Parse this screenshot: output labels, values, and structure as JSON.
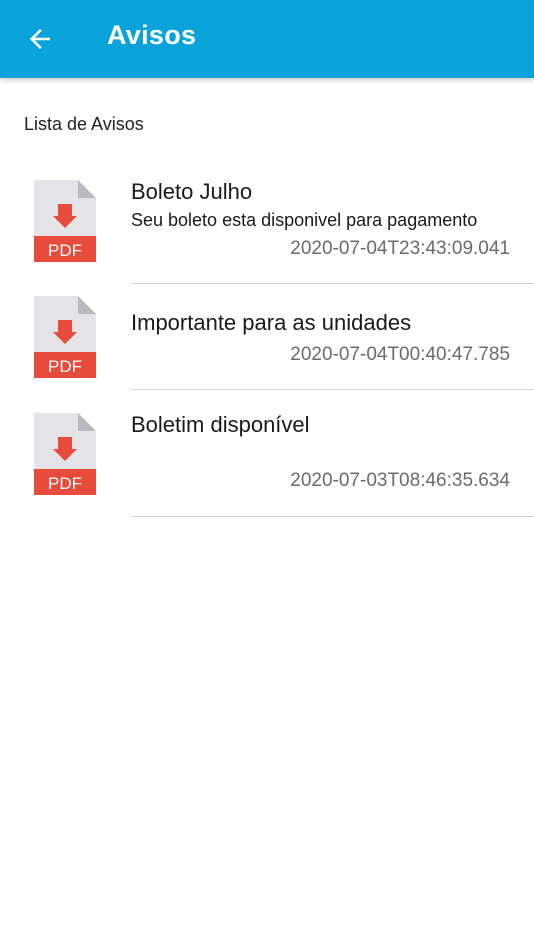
{
  "appbar": {
    "title": "Avisos",
    "back_icon": "arrow-left-icon",
    "color": "#0aa3d9"
  },
  "section_label": "Lista de Avisos",
  "notices": [
    {
      "title": "Boleto Julho",
      "subtitle": "Seu boleto esta disponivel para pagamento",
      "date": "2020-07-04T23:43:09.041",
      "icon": "pdf-file-icon",
      "icon_label": "PDF"
    },
    {
      "title": "Importante para as unidades",
      "subtitle": "",
      "date": "2020-07-04T00:40:47.785",
      "icon": "pdf-file-icon",
      "icon_label": "PDF"
    },
    {
      "title": "Boletim disponível",
      "subtitle": "",
      "date": "2020-07-03T08:46:35.634",
      "icon": "pdf-file-icon",
      "icon_label": "PDF"
    }
  ]
}
